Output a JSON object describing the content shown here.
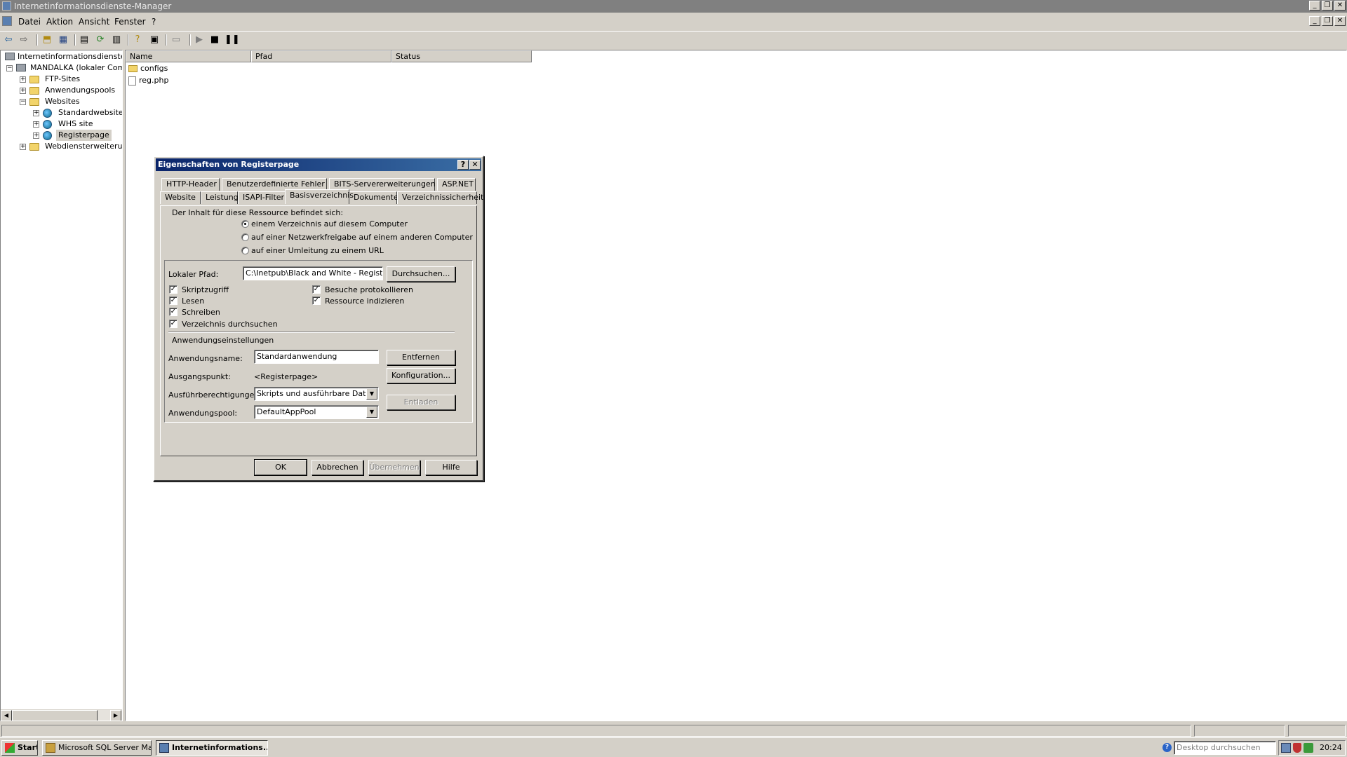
{
  "window": {
    "title": "Internetinformationsdienste-Manager"
  },
  "menu": {
    "items": [
      "Datei",
      "Aktion",
      "Ansicht",
      "Fenster",
      "?"
    ]
  },
  "tree": {
    "root": "Internetinformationsdienste",
    "computer": "MANDALKA (lokaler Compu",
    "ftp": "FTP-Sites",
    "pools": "Anwendungspools",
    "websites": "Websites",
    "site1": "Standardwebsite",
    "site2": "WHS site",
    "site3": "Registerpage",
    "ext": "Webdiensterweiterung"
  },
  "list": {
    "columns": [
      "Name",
      "Pfad",
      "Status"
    ],
    "rows": [
      {
        "name": "configs"
      },
      {
        "name": "reg.php"
      }
    ]
  },
  "dialog": {
    "title": "Eigenschaften von Registerpage",
    "help_btn": "?",
    "close_btn": "✕",
    "tabs_row1": [
      "HTTP-Header",
      "Benutzerdefinierte Fehler",
      "BITS-Servererweiterungen",
      "ASP.NET"
    ],
    "tabs_row2": [
      "Website",
      "Leistung",
      "ISAPI-Filter",
      "Basisverzeichnis",
      "Dokumente",
      "Verzeichnissicherheit"
    ],
    "content_label": "Der Inhalt für diese Ressource befindet sich:",
    "radio1": "einem Verzeichnis auf diesem Computer",
    "radio2": "auf einer Netzwerkfreigabe auf einem anderen Computer",
    "radio3": "auf einer Umleitung zu einem URL",
    "local_path_label": "Lokaler Pfad:",
    "local_path_value": "C:\\Inetpub\\Black and White - Registersc",
    "browse_btn": "Durchsuchen...",
    "chk_script": "Skriptzugriff",
    "chk_read": "Lesen",
    "chk_write": "Schreiben",
    "chk_browse": "Verzeichnis durchsuchen",
    "chk_log": "Besuche protokollieren",
    "chk_index": "Ressource indizieren",
    "check_mark": "✓",
    "app_settings": "Anwendungseinstellungen",
    "app_name_label": "Anwendungsname:",
    "app_name_value": "Standardanwendung",
    "remove_btn": "Entfernen",
    "start_label": "Ausgangspunkt:",
    "start_value": "<Registerpage>",
    "config_btn": "Konfiguration...",
    "exec_label": "Ausführberechtigungen:",
    "exec_value": "Skripts und ausführbare Dateien",
    "unload_btn": "Entladen",
    "pool_label": "Anwendungspool:",
    "pool_value": "DefaultAppPool",
    "ok": "OK",
    "cancel": "Abbrechen",
    "apply": "Übernehmen",
    "help": "Hilfe"
  },
  "taskbar": {
    "start": "Start",
    "task1": "Microsoft SQL Server Ma...",
    "task2": "Internetinformations...",
    "search_placeholder": "Desktop durchsuchen",
    "clock": "20:24"
  }
}
